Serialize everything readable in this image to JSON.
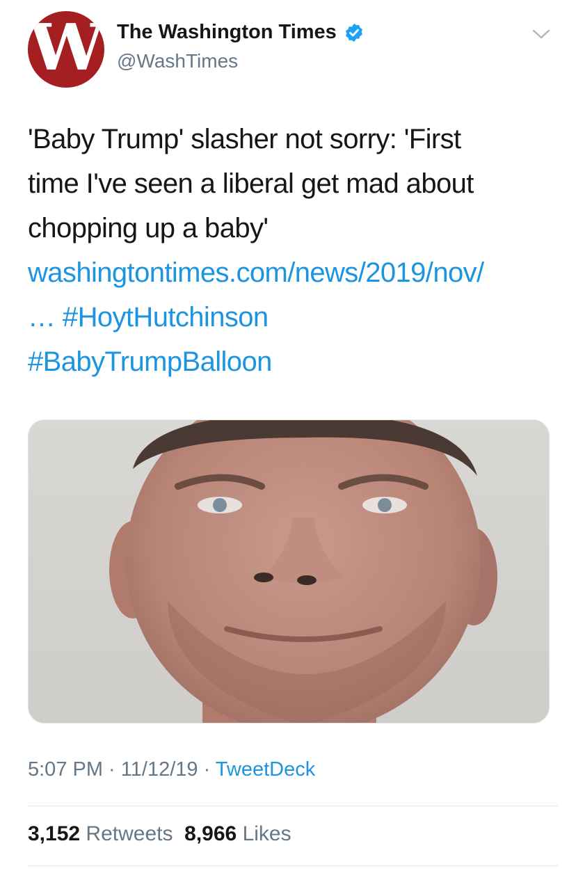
{
  "account": {
    "avatar_letter": "W",
    "display_name": "The Washington Times",
    "handle": "@WashTimes",
    "verified": true,
    "avatar_color": "#a51e22"
  },
  "tweet": {
    "text_lines": [
      "'Baby Trump' slasher not sorry: 'First",
      "time I've seen a liberal get mad about",
      "chopping up a baby'"
    ],
    "link": "washingtontimes.com/news/2019/nov/",
    "link_ellipsis": "…",
    "hashtag_1": "#HoytHutchinson",
    "hashtag_2": "#BabyTrumpBalloon",
    "media_description_icon": "photo-portrait"
  },
  "meta": {
    "time": "5:07 PM",
    "separator": " · ",
    "date": "11/12/19",
    "source": "TweetDeck"
  },
  "stats": {
    "retweets_count": "3,152",
    "retweets_label": "Retweets",
    "likes_count": "8,966",
    "likes_label": "Likes"
  },
  "colors": {
    "link": "#1b95e0",
    "secondary_text": "#657786",
    "verified_badge": "#1da1f2"
  }
}
